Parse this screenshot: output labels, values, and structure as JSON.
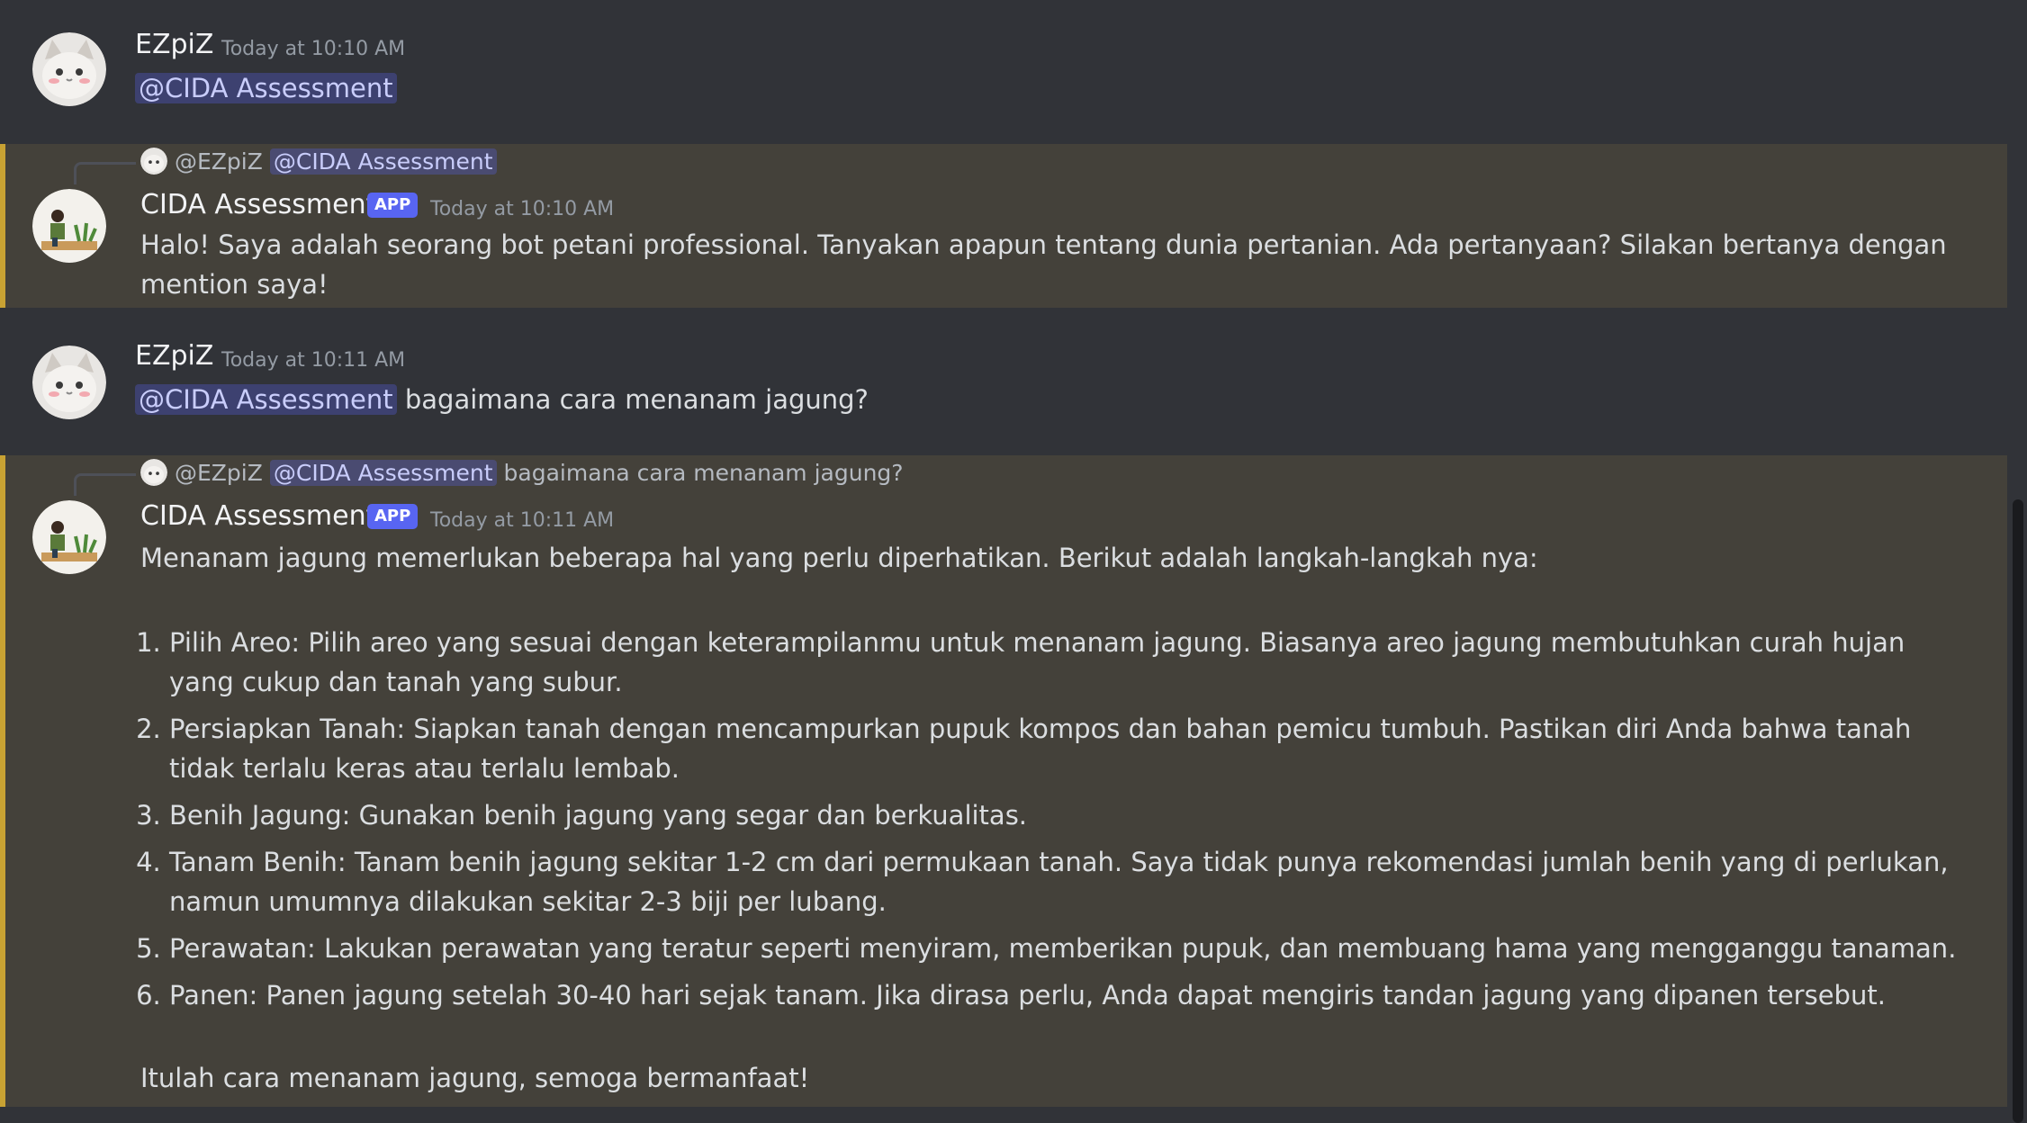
{
  "messages": [
    {
      "username": "EZpiZ",
      "timestamp": "Today at 10:10 AM",
      "mention": "@CIDA Assessment",
      "text": ""
    },
    {
      "reply": {
        "user": "@EZpiZ",
        "mention": "@CIDA Assessment",
        "text": ""
      },
      "username": "CIDA Assessment",
      "badge": "APP",
      "timestamp": "Today at 10:10 AM",
      "text": "Halo! Saya adalah seorang bot petani professional. Tanyakan apapun tentang dunia pertanian. Ada pertanyaan? Silakan bertanya dengan mention saya!"
    },
    {
      "username": "EZpiZ",
      "timestamp": "Today at 10:11 AM",
      "mention": "@CIDA Assessment",
      "text": "bagaimana cara menanam jagung?"
    },
    {
      "reply": {
        "user": "@EZpiZ",
        "mention": "@CIDA Assessment",
        "text": "bagaimana cara menanam jagung?"
      },
      "username": "CIDA Assessment",
      "badge": "APP",
      "timestamp": "Today at 10:11 AM",
      "intro": "Menanam jagung memerlukan beberapa hal yang perlu diperhatikan. Berikut adalah langkah-langkah nya:",
      "steps": [
        "Pilih Areo: Pilih areo yang sesuai dengan keterampilanmu untuk menanam jagung. Biasanya areo jagung membutuhkan curah hujan yang cukup dan tanah yang subur.",
        "Persiapkan Tanah: Siapkan tanah dengan mencampurkan pupuk kompos dan bahan pemicu tumbuh. Pastikan diri Anda bahwa tanah tidak terlalu keras atau terlalu lembab.",
        "Benih Jagung: Gunakan benih jagung yang segar dan berkualitas.",
        "Tanam Benih: Tanam benih jagung sekitar 1-2 cm dari permukaan tanah. Saya tidak punya rekomendasi jumlah benih yang di perlukan, namun umumnya dilakukan sekitar 2-3 biji per lubang.",
        "Perawatan: Lakukan perawatan yang teratur seperti menyiram, memberikan pupuk, dan membuang hama yang mengganggu tanaman.",
        "Panen: Panen jagung setelah 30-40 hari sejak tanam. Jika dirasa perlu, Anda dapat mengiris tandan jagung yang dipanen tersebut."
      ],
      "outro": "Itulah cara menanam jagung, semoga bermanfaat!"
    }
  ],
  "colors": {
    "highlight_bar": "#c8a233",
    "mention_bg": "#5865f2",
    "badge": "#5865f2"
  },
  "icons": {
    "user_avatar": "cat-avatar-icon",
    "bot_avatar": "farmer-avatar-icon"
  }
}
